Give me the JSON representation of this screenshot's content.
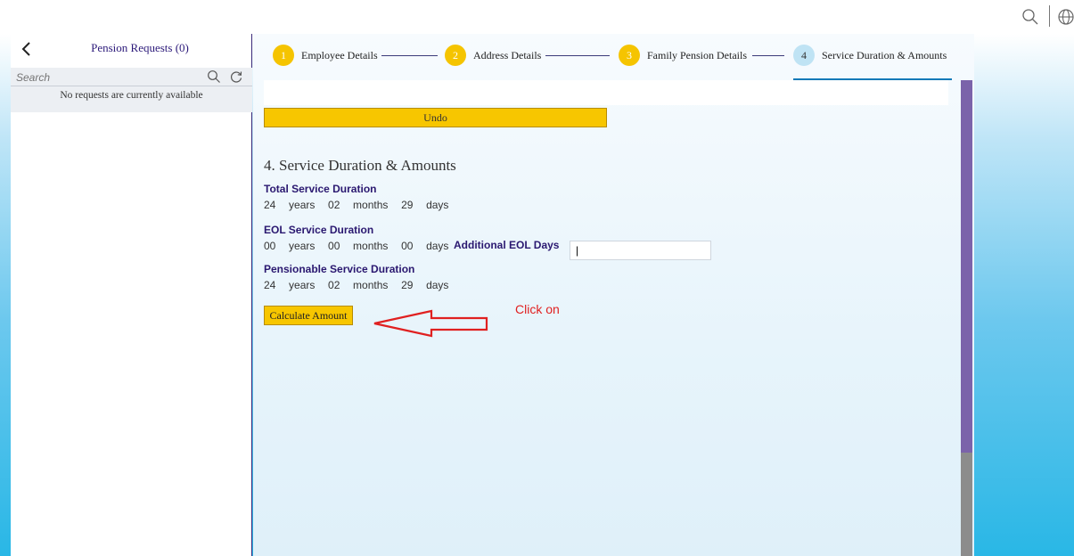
{
  "topbar": {
    "icons": [
      "search-icon",
      "globe-icon"
    ]
  },
  "left_panel": {
    "title": "Pension Requests (0)",
    "search_placeholder": "Search",
    "empty_message": "No requests are currently available",
    "icons": [
      "back-chevron-icon",
      "search-icon",
      "refresh-icon"
    ]
  },
  "stepper": {
    "steps": [
      {
        "number": "1",
        "label": "Employee Details",
        "status": "completed"
      },
      {
        "number": "2",
        "label": "Address Details",
        "status": "completed"
      },
      {
        "number": "3",
        "label": "Family Pension Details",
        "status": "completed"
      },
      {
        "number": "4",
        "label": "Service Duration & Amounts",
        "status": "active"
      }
    ]
  },
  "main": {
    "undo_label": "Undo",
    "section_title": "4. Service Duration & Amounts",
    "total_service": {
      "label": "Total Service Duration",
      "value": "24  years  02  months  29  days"
    },
    "eol_service": {
      "label": "EOL Service Duration",
      "value": "00  years  00  months  00  days",
      "additional_label": "Additional EOL Days",
      "additional_value": "|"
    },
    "pensionable_service": {
      "label": "Pensionable Service Duration",
      "value": "24  years  02  months  29  days"
    },
    "calculate_label": "Calculate Amount",
    "annotation_text": "Click on"
  },
  "colors": {
    "accent_yellow": "#f7c600",
    "brand_purple": "#2a1870",
    "annotation_red": "#e02020",
    "scrollbar_thumb": "#7b63aa"
  }
}
